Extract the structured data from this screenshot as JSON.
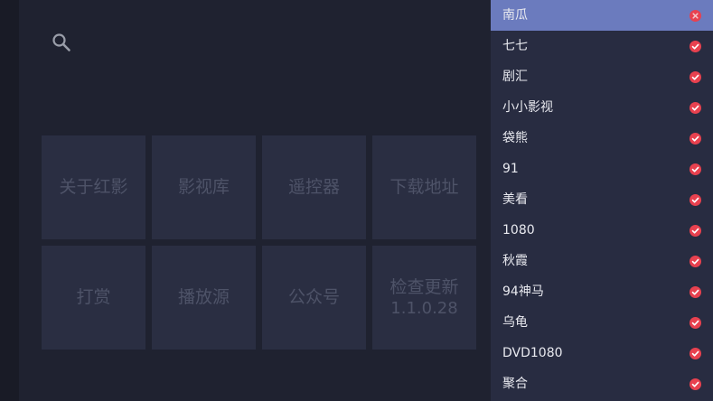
{
  "search": {
    "icon": "search-icon"
  },
  "tiles": [
    {
      "lines": [
        "关于红影"
      ]
    },
    {
      "lines": [
        "影视库"
      ]
    },
    {
      "lines": [
        "遥控器"
      ]
    },
    {
      "lines": [
        "下载地址"
      ]
    },
    {
      "lines": [
        "打赏"
      ]
    },
    {
      "lines": [
        "播放源"
      ]
    },
    {
      "lines": [
        "公众号"
      ]
    },
    {
      "lines": [
        "检查更新",
        "1.1.0.28"
      ]
    }
  ],
  "sources": {
    "selected_index": 0,
    "items": [
      {
        "label": "南瓜",
        "status": "selected"
      },
      {
        "label": "七七",
        "status": "ok"
      },
      {
        "label": "剧汇",
        "status": "ok"
      },
      {
        "label": "小小影视",
        "status": "ok"
      },
      {
        "label": "袋熊",
        "status": "ok"
      },
      {
        "label": "91",
        "status": "ok"
      },
      {
        "label": "美看",
        "status": "ok"
      },
      {
        "label": "1080",
        "status": "ok"
      },
      {
        "label": "秋霞",
        "status": "ok"
      },
      {
        "label": "94神马",
        "status": "ok"
      },
      {
        "label": "乌龟",
        "status": "ok"
      },
      {
        "label": "DVD1080",
        "status": "ok"
      },
      {
        "label": "聚合",
        "status": "ok"
      }
    ]
  },
  "colors": {
    "background": "#1f2230",
    "tile": "#2a2e42",
    "tile_text": "#4e5368",
    "panel": "#282c41",
    "selected_row": "#6b7bbe",
    "check_red": "#e8414f"
  }
}
